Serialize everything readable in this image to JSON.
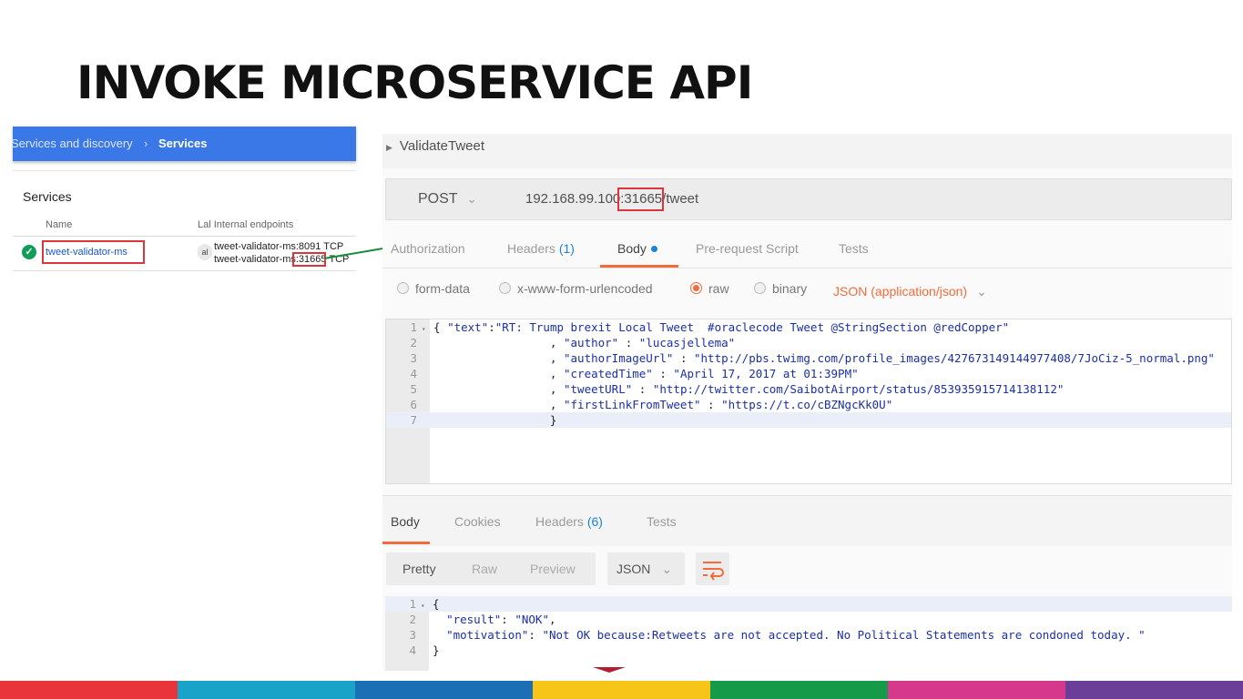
{
  "slide": {
    "title": "INVOKE MICROSERVICE API"
  },
  "services_panel": {
    "breadcrumb_parent": "Services and discovery",
    "breadcrumb_separator": "›",
    "breadcrumb_current": "Services",
    "card_title": "Services",
    "columns": {
      "name": "Name",
      "endpoints": "Lal Internal endpoints"
    },
    "row": {
      "status_icon": "check-circle-icon",
      "name": "tweet-validator-ms",
      "endpoint_icon_text": "al",
      "endpoint_1": "tweet-validator-ms:8091 TCP",
      "endpoint_2": "tweet-validator-ms:31665 TCP"
    }
  },
  "postman": {
    "request_name": "ValidateTweet",
    "method": "POST",
    "url": "192.168.99.100:31665/tweet",
    "request_tabs": {
      "authorization": "Authorization",
      "headers": "Headers",
      "headers_count": "(1)",
      "body": "Body",
      "prerequest": "Pre-request Script",
      "tests": "Tests"
    },
    "body_options": {
      "form_data": "form-data",
      "urlencoded": "x-www-form-urlencoded",
      "raw": "raw",
      "binary": "binary",
      "selected": "raw",
      "content_type": "JSON (application/json)"
    },
    "request_body_lines": [
      {
        "n": "1",
        "fold": "▾",
        "text": "{ \"text\":\"RT: Trump brexit Local Tweet  #oraclecode Tweet @StringSection @redCopper\""
      },
      {
        "n": "2",
        "fold": "",
        "text": "                 , \"author\" : \"lucasjellema\""
      },
      {
        "n": "3",
        "fold": "",
        "text": "                 , \"authorImageUrl\" : \"http://pbs.twimg.com/profile_images/427673149144977408/7JoCiz-5_normal.png\""
      },
      {
        "n": "4",
        "fold": "",
        "text": "                 , \"createdTime\" : \"April 17, 2017 at 01:39PM\""
      },
      {
        "n": "5",
        "fold": "",
        "text": "                 , \"tweetURL\" : \"http://twitter.com/SaibotAirport/status/853935915714138112\""
      },
      {
        "n": "6",
        "fold": "",
        "text": "                 , \"firstLinkFromTweet\" : \"https://t.co/cBZNgcKk0U\""
      },
      {
        "n": "7",
        "fold": "",
        "text": "                 }"
      }
    ],
    "response_tabs": {
      "body": "Body",
      "cookies": "Cookies",
      "headers": "Headers",
      "headers_count": "(6)",
      "tests": "Tests"
    },
    "view_tabs": {
      "pretty": "Pretty",
      "raw": "Raw",
      "preview": "Preview"
    },
    "format": "JSON",
    "wrap_icon": "wrap-lines-icon",
    "response_lines": [
      {
        "n": "1",
        "fold": "▾",
        "text": "{"
      },
      {
        "n": "2",
        "fold": "",
        "text": "  \"result\": \"NOK\","
      },
      {
        "n": "3",
        "fold": "",
        "text": "  \"motivation\": \"Not OK because:Retweets are not accepted. No Political Statements are condoned today. \""
      },
      {
        "n": "4",
        "fold": "",
        "text": "}"
      }
    ]
  },
  "colors": {
    "accent": "#f26b3a",
    "link_blue": "#1d85d6",
    "header_blue": "#3b78e7",
    "highlight_red": "#d9363e",
    "arrow_green": "#1b8a3a",
    "footer_stripes": [
      "#e8343a",
      "#1aa3c8",
      "#1a6fb5",
      "#f7c518",
      "#159a49",
      "#d6398b",
      "#6b3f98"
    ]
  }
}
